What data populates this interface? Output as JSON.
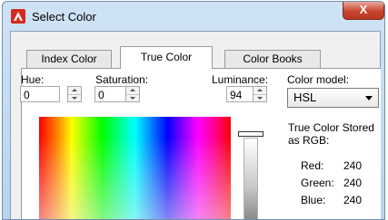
{
  "window": {
    "title": "Select Color",
    "close_glyph": "X",
    "app_icon": "autocad-a-icon"
  },
  "tabs": [
    {
      "label": "Index Color",
      "active": false
    },
    {
      "label": "True Color",
      "active": true
    },
    {
      "label": "Color Books",
      "active": false
    }
  ],
  "fields": {
    "hue": {
      "label": "Hue:",
      "value": "0"
    },
    "saturation": {
      "label": "Saturation:",
      "value": "0"
    },
    "luminance": {
      "label": "Luminance:",
      "value": "94"
    }
  },
  "color_model": {
    "label": "Color model:",
    "selected": "HSL"
  },
  "rgb_info": {
    "heading_line1": "True Color Stored",
    "heading_line2": "as RGB:",
    "red_label": "Red:",
    "red_value": "240",
    "green_label": "Green:",
    "green_value": "240",
    "blue_label": "Blue:",
    "blue_value": "240"
  },
  "colors": {
    "titlebar": "#c4dbf3",
    "close_button": "#c9452f",
    "tab_panel": "#ffffff"
  }
}
